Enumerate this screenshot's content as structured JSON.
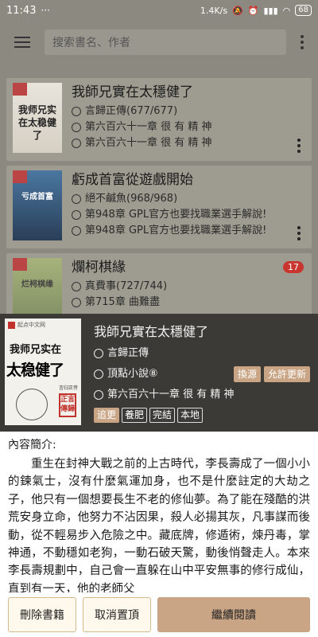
{
  "status_bar": {
    "time": "11:43",
    "speed": "1.4K/s",
    "battery": "68"
  },
  "toolbar": {
    "search_placeholder": "搜索書名、作者"
  },
  "books": [
    {
      "title": "我師兄實在太穩健了",
      "cover_text": "我师兄实在太稳健了",
      "author": "言歸正傳(677/677)",
      "latest": "第六百六十一章 很 有 精 神",
      "unread": ""
    },
    {
      "title": "虧成首富從遊戲開始",
      "cover_text": "亏成首富",
      "author": "絕不鹹魚(968/968)",
      "latest": "第948章 GPL官方也要找職業選手解說!",
      "latest2": "第948章 GPL官方也要找職業選手解說!",
      "unread": ""
    },
    {
      "title": "爛柯棋緣",
      "cover_text": "烂柯棋缘",
      "author": "真費事(727/744)",
      "latest": "第715章 曲難盡",
      "unread": "17"
    }
  ],
  "detail": {
    "title": "我師兄實在太穩健了",
    "cover": {
      "logo": "起点中文网",
      "line1": "我师兄实在",
      "line2": "太稳健了",
      "author_tag": "言归正传",
      "seal": "正言傳歸"
    },
    "author": "言歸正傳",
    "source": "頂點小說⑧",
    "change_source": "換源",
    "allow_update": "允許更新",
    "latest": "第六百六十一章 很 有 精 神",
    "tags": [
      "追更",
      "養肥",
      "完結",
      "本地"
    ]
  },
  "intro": {
    "label": "內容簡介:",
    "text": "重生在封神大戰之前的上古時代，李長壽成了一個小小的鍊氣士，沒有什麼氣運加身，也不是什麼註定的大劫之子，他只有一個想要長生不老的修仙夢。為了能在殘酷的洪荒安身立命，他努力不沾因果，殺人必揚其灰，凡事謀而後動，從不輕易步入危險之中。藏底牌，修遁術，煉丹毒，掌神通，不動穩如老狗，一動石破天驚，動後悄聲走人。本來李長壽規劃中，自己會一直躲在山中平安無事的修行成仙，直到有一天，他的老師父"
  },
  "actions": {
    "delete": "刪除書籍",
    "unpin": "取消置頂",
    "continue": "繼續閱讀"
  }
}
